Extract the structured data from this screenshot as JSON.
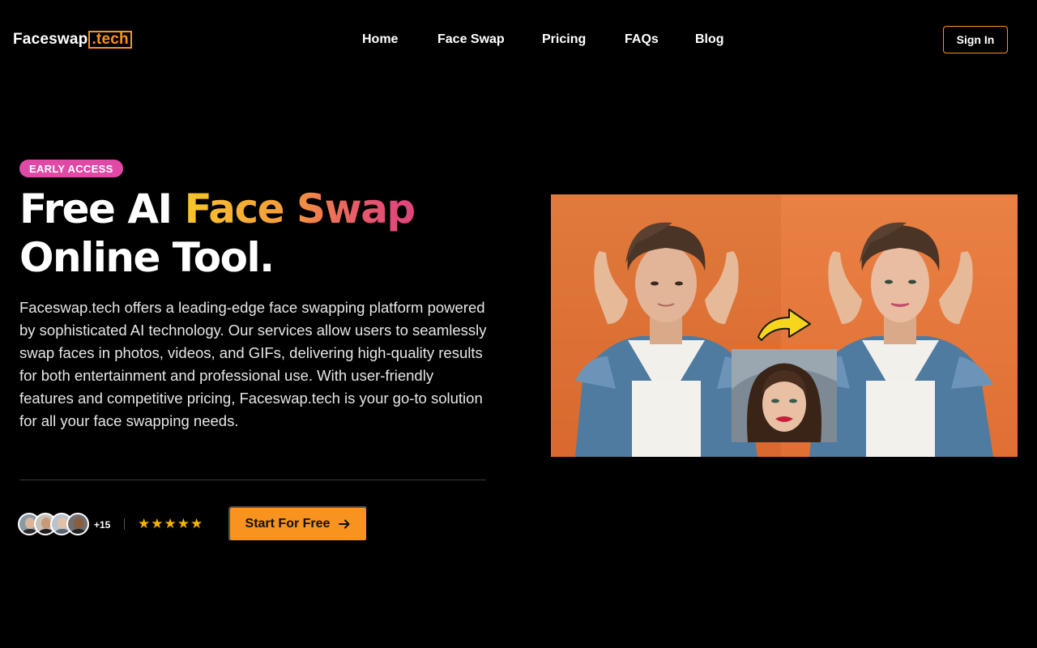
{
  "brand": {
    "name_main": "Faceswap",
    "name_tld": ".tech",
    "accent": "#f7931e"
  },
  "nav": {
    "items": [
      {
        "label": "Home"
      },
      {
        "label": "Face Swap"
      },
      {
        "label": "Pricing"
      },
      {
        "label": "FAQs"
      },
      {
        "label": "Blog"
      }
    ],
    "signin_label": "Sign In"
  },
  "hero": {
    "badge": "EARLY ACCESS",
    "title_part1": "Free AI ",
    "title_highlight": "Face Swap",
    "title_part2": "Online Tool.",
    "description": "Faceswap.tech offers a leading-edge face swapping platform powered by sophisticated AI technology. Our services allow users to seamlessly swap faces in photos, videos, and GIFs, delivering high-quality results for both entertainment and professional use. With user-friendly features and competitive pricing, Faceswap.tech is your go-to solution for all your face swapping needs.",
    "user_count": "+15",
    "rating": 5,
    "cta_label": "Start For Free"
  },
  "colors": {
    "badge": "#e04aa6",
    "star": "#f4b400",
    "gradient": [
      "#f7c52a",
      "#f39b3b",
      "#e85a6a",
      "#e0437e"
    ]
  }
}
